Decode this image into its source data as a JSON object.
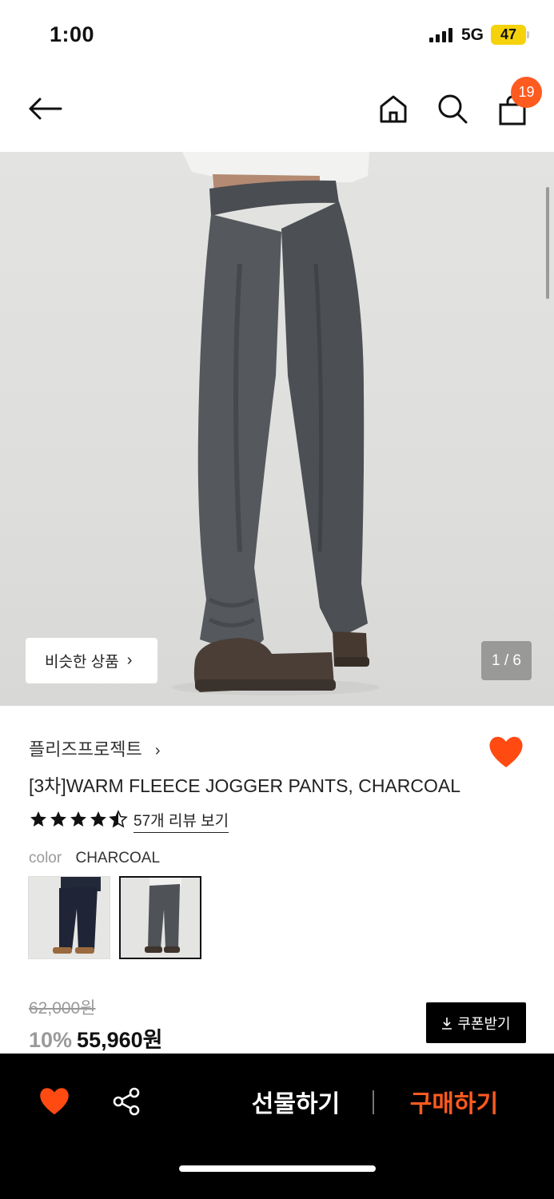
{
  "status": {
    "time": "1:00",
    "network": "5G",
    "battery": "47"
  },
  "nav": {
    "cart_count": "19"
  },
  "gallery": {
    "similar_label": "비슷한 상품",
    "counter": "1 / 6"
  },
  "product": {
    "brand": "플리즈프로젝트",
    "title": "[3차]WARM FLEECE JOGGER PANTS, CHARCOAL",
    "rating": 4.5,
    "review_link": "57개 리뷰 보기",
    "color_label": "color",
    "color_value": "CHARCOAL"
  },
  "price": {
    "original": "62,000원",
    "discount": "10%",
    "sale": "55,960원",
    "coupon_label": "쿠폰받기"
  },
  "bottom": {
    "gift_label": "선물하기",
    "buy_label": "구매하기"
  },
  "colors": {
    "accent": "#ff5a1f",
    "heart": "#ff4a12"
  }
}
